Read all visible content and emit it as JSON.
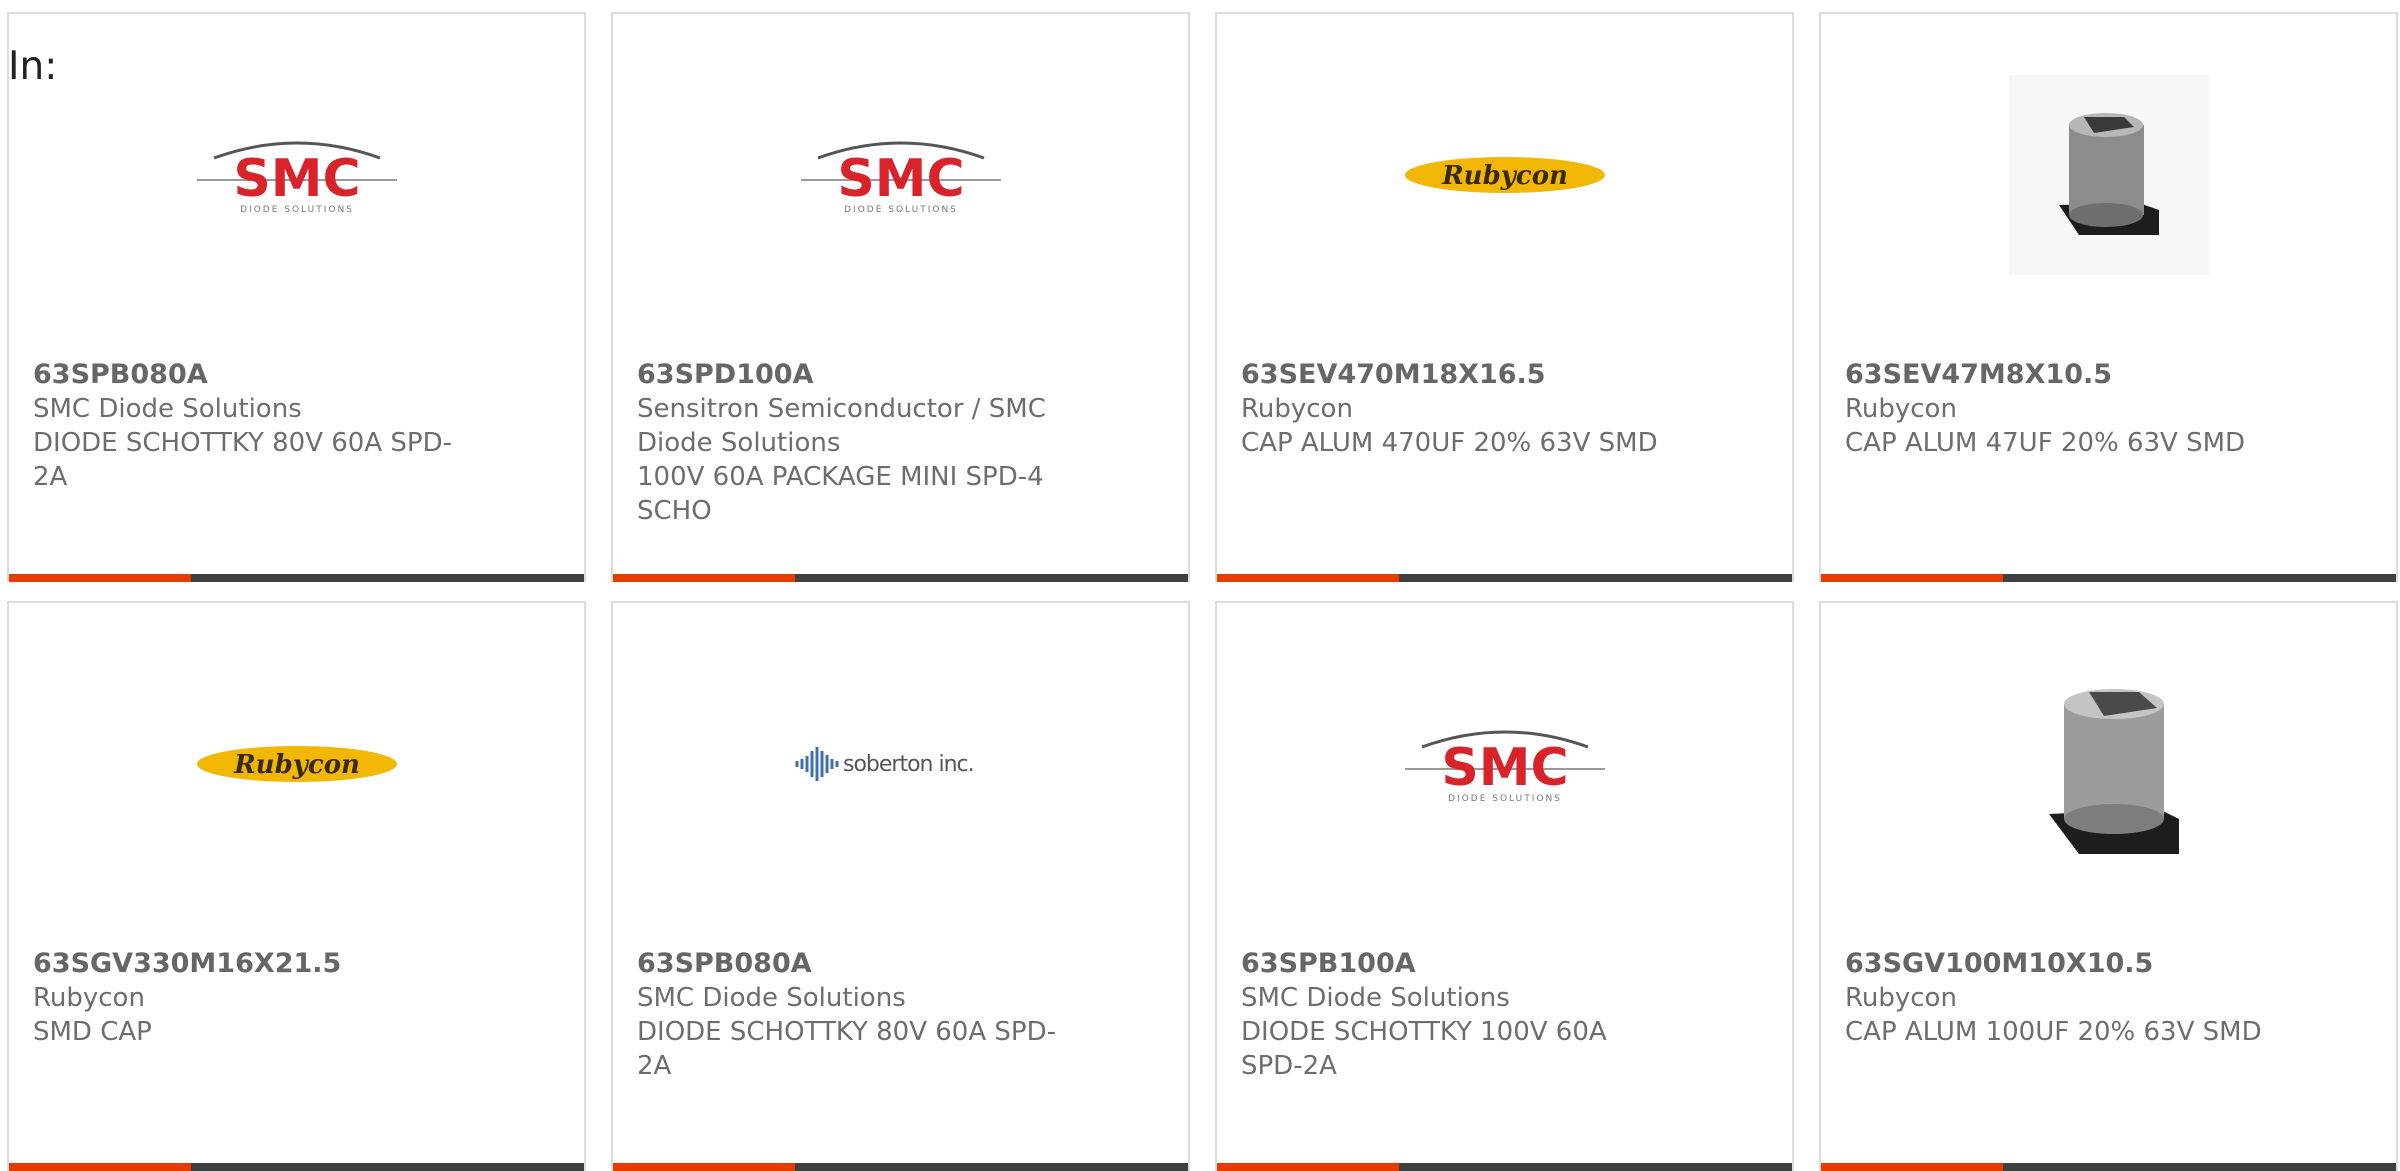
{
  "header": {
    "in_label": "In:"
  },
  "colors": {
    "accent": "#e53c00",
    "bar": "#404040",
    "border": "#dcdcdc",
    "text": "#6d6d6d"
  },
  "logos": {
    "smc_text": "SMC",
    "smc_sub": "DIODE SOLUTIONS",
    "rubycon_text": "Rubycon",
    "soberton_text": "soberton inc."
  },
  "cards": [
    {
      "part": "63SPB080A",
      "maker": "SMC Diode Solutions",
      "desc": "DIODE SCHOTTKY 80V 60A SPD-2A",
      "image": "smc-logo"
    },
    {
      "part": "63SPD100A",
      "maker": "Sensitron Semiconductor / SMC Diode Solutions",
      "desc": "100V 60A PACKAGE MINI SPD-4 SCHO",
      "image": "smc-logo"
    },
    {
      "part": "63SEV470M18X16.5",
      "maker": "Rubycon",
      "desc": "CAP ALUM 470UF 20% 63V SMD",
      "image": "rubycon-logo"
    },
    {
      "part": "63SEV47M8X10.5",
      "maker": "Rubycon",
      "desc": "CAP ALUM 47UF 20% 63V SMD",
      "image": "capacitor-photo"
    },
    {
      "part": "63SGV330M16X21.5",
      "maker": "Rubycon",
      "desc": "SMD CAP",
      "image": "rubycon-logo"
    },
    {
      "part": "63SPB080A",
      "maker": "SMC Diode Solutions",
      "desc": "DIODE SCHOTTKY 80V 60A SPD-2A",
      "image": "soberton-logo"
    },
    {
      "part": "63SPB100A",
      "maker": "SMC Diode Solutions",
      "desc": "DIODE SCHOTTKY 100V 60A SPD-2A",
      "image": "smc-logo"
    },
    {
      "part": "63SGV100M10X10.5",
      "maker": "Rubycon",
      "desc": "CAP ALUM 100UF 20% 63V SMD",
      "image": "capacitor-photo"
    }
  ]
}
